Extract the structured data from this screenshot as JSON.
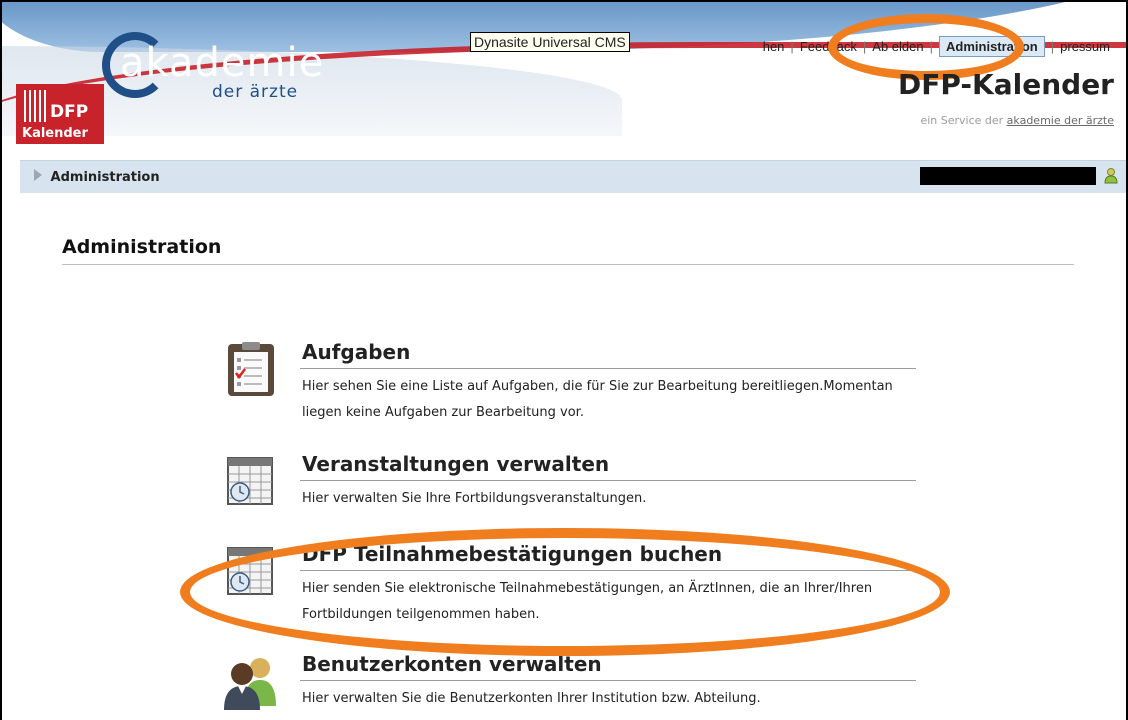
{
  "header": {
    "logo_text": "akademie",
    "logo_subtext": "der ärzte",
    "badge_line1": "DFP",
    "badge_line2": "Kalender",
    "tooltip": "Dynasite Universal CMS",
    "nav": {
      "item1": "hen",
      "item2": "Feedback",
      "item3": "Ab  elden",
      "item4": "Administration",
      "item5": "pressum"
    },
    "site_title": "DFP-Kalender",
    "site_sub_prefix": "ein Service der",
    "site_sub_link": "akademie der ärzte"
  },
  "breadcrumb": {
    "label": "Administration"
  },
  "main": {
    "title": "Administration",
    "items": [
      {
        "title": "Aufgaben",
        "description": "Hier sehen Sie eine Liste auf Aufgaben, die für Sie zur Bearbeitung bereitliegen.Momentan liegen keine Aufgaben zur Bearbeitung vor.",
        "icon": "clipboard-checklist-icon"
      },
      {
        "title": "Veranstaltungen verwalten",
        "description": "Hier verwalten Sie Ihre Fortbildungsveranstaltungen.",
        "icon": "calendar-icon"
      },
      {
        "title": "DFP Teilnahmebestätigungen buchen",
        "description": "Hier senden Sie elektronische Teilnahmebestätigungen, an ÄrztInnen, die an Ihrer/Ihren Fortbildungen teilgenommen haben.",
        "icon": "calendar-icon"
      },
      {
        "title": "Benutzerkonten verwalten",
        "description": "Hier verwalten Sie die Benutzerkonten Ihrer Institution bzw. Abteilung.",
        "icon": "users-icon"
      }
    ]
  },
  "colors": {
    "highlight_oval": "#f07d1e",
    "brand_red": "#c8222b",
    "brand_blue": "#1f4f86",
    "breadcrumb_bg": "#d7e4ef"
  }
}
